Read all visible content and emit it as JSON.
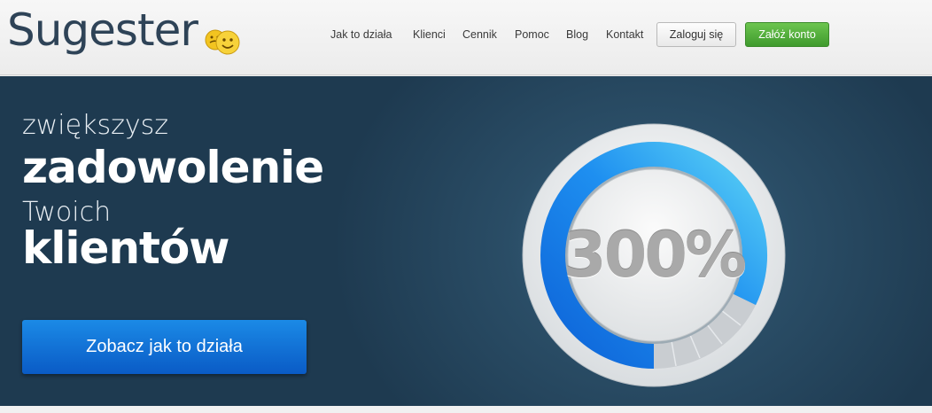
{
  "header": {
    "logo_text": "Sugester",
    "nav": [
      {
        "label": "Jak to działa"
      },
      {
        "label": "Klienci"
      },
      {
        "label": "Cennik"
      },
      {
        "label": "Pomoc"
      },
      {
        "label": "Blog"
      },
      {
        "label": "Kontakt"
      }
    ],
    "login_label": "Zaloguj się",
    "signup_label": "Załóż konto"
  },
  "hero": {
    "line1": "zwiększysz",
    "line2": "zadowolenie",
    "line3": "Twoich",
    "line4": "klientów",
    "cta_label": "Zobacz jak to działa",
    "gauge_label": "300%"
  },
  "colors": {
    "brand_dark": "#2e4357",
    "signup_green": "#4caf3a",
    "cta_blue": "#0d6fd6",
    "gauge_blue": "#1e8ff0"
  }
}
